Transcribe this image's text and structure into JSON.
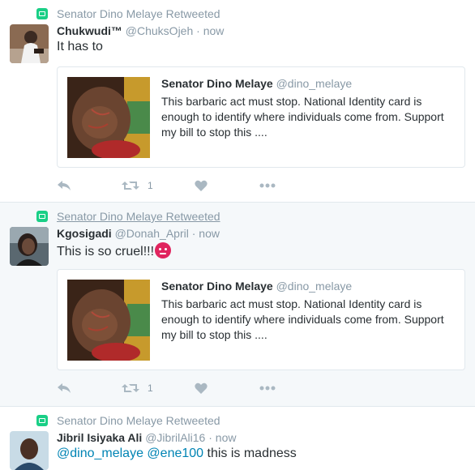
{
  "tweets": [
    {
      "retweeted_by": "Senator Dino Melaye Retweeted",
      "name": "Chukwudi™",
      "handle": "@ChuksOjeh",
      "dot": "·",
      "time": "now",
      "text": "It has to",
      "quote": {
        "name": "Senator Dino Melaye",
        "handle": "@dino_melaye",
        "text": "This barbaric act must stop. National Identity card is enough to identify where individuals come from. Support my bill to stop this ...."
      },
      "retweet_count": "1"
    },
    {
      "retweeted_by": "Senator Dino Melaye Retweeted",
      "name": "Kgosigadi",
      "handle": "@Donah_April",
      "dot": "·",
      "time": "now",
      "text": "This is so cruel!!!",
      "emoji": "angry-face",
      "quote": {
        "name": "Senator Dino Melaye",
        "handle": "@dino_melaye",
        "text": "This barbaric act must stop. National Identity card is enough to identify where individuals come from. Support my bill to stop this ...."
      },
      "retweet_count": "1"
    },
    {
      "retweeted_by": "Senator Dino Melaye Retweeted",
      "name": "Jibril Isiyaka Ali",
      "handle": "@JibrilAli16",
      "dot": "·",
      "time": "now",
      "mention1": "@dino_melaye",
      "mention2": "@ene100",
      "text_rest": " this is madness"
    }
  ],
  "colors": {
    "retweet_green": "#19cf86",
    "link_blue": "#0084b4",
    "muted": "#8899a6",
    "hover_bg": "#f5f8fa"
  },
  "icons": [
    "retweeted-icon",
    "reply-icon",
    "retweet-icon",
    "like-icon",
    "more-icon"
  ]
}
